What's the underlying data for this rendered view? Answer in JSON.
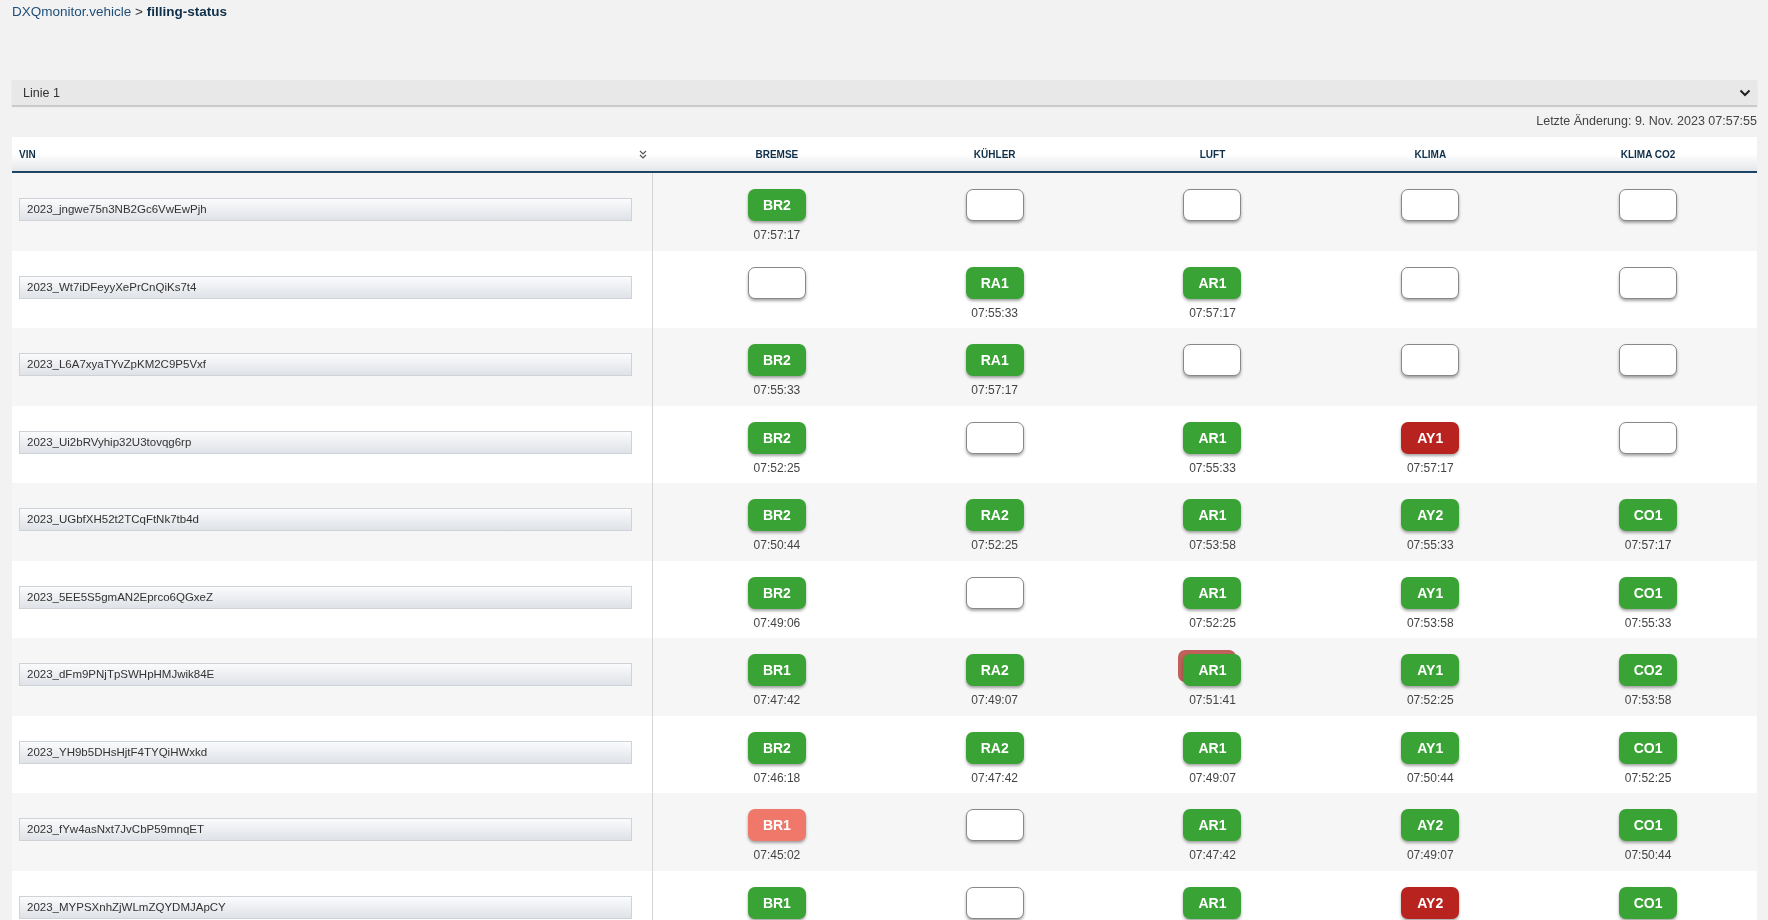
{
  "breadcrumb": {
    "parent": "DXQmonitor.vehicle",
    "separator": ">",
    "current": "filling-status"
  },
  "line_select": {
    "value": "Linie 1"
  },
  "last_change": "Letzte Änderung: 9. Nov. 2023 07:57:55",
  "columns": [
    "VIN",
    "BREMSE",
    "KÜHLER",
    "LUFT",
    "KLIMA",
    "KLIMA CO2"
  ],
  "rows": [
    {
      "vin": "2023_jngwe75n3NB2Gc6VwEwPjh",
      "cells": [
        {
          "color": "#3aa335",
          "label": "BR2",
          "time": "07:57:17"
        },
        {
          "color": "#ffffff"
        },
        {
          "color": "#ffffff"
        },
        {
          "color": "#ffffff"
        },
        {
          "color": "#ffffff"
        }
      ]
    },
    {
      "vin": "2023_Wt7iDFeyyXePrCnQiKs7t4",
      "cells": [
        {
          "color": "#ffffff"
        },
        {
          "color": "#3aa335",
          "label": "RA1",
          "time": "07:55:33"
        },
        {
          "color": "#3aa335",
          "label": "AR1",
          "time": "07:57:17"
        },
        {
          "color": "#ffffff"
        },
        {
          "color": "#ffffff"
        }
      ]
    },
    {
      "vin": "2023_L6A7xyaTYvZpKM2C9P5Vxf",
      "cells": [
        {
          "color": "#3aa335",
          "label": "BR2",
          "time": "07:55:33"
        },
        {
          "color": "#3aa335",
          "label": "RA1",
          "time": "07:57:17"
        },
        {
          "color": "#ffffff"
        },
        {
          "color": "#ffffff"
        },
        {
          "color": "#ffffff"
        }
      ]
    },
    {
      "vin": "2023_Ui2bRVyhip32U3tovqg6rp",
      "cells": [
        {
          "color": "#3aa335",
          "label": "BR2",
          "time": "07:52:25"
        },
        {
          "color": "#ffffff"
        },
        {
          "color": "#3aa335",
          "label": "AR1",
          "time": "07:55:33"
        },
        {
          "color": "#b8231f",
          "label": "AY1",
          "time": "07:57:17"
        },
        {
          "color": "#ffffff"
        }
      ]
    },
    {
      "vin": "2023_UGbfXH52t2TCqFtNk7tb4d",
      "cells": [
        {
          "color": "#3aa335",
          "label": "BR2",
          "time": "07:50:44"
        },
        {
          "color": "#3aa335",
          "label": "RA2",
          "time": "07:52:25"
        },
        {
          "color": "#3aa335",
          "label": "AR1",
          "time": "07:53:58"
        },
        {
          "color": "#3aa335",
          "label": "AY2",
          "time": "07:55:33"
        },
        {
          "color": "#3aa335",
          "label": "CO1",
          "time": "07:57:17"
        }
      ]
    },
    {
      "vin": "2023_5EE5S5gmAN2Eprco6QGxeZ",
      "cells": [
        {
          "color": "#3aa335",
          "label": "BR2",
          "time": "07:49:06"
        },
        {
          "color": "#ffffff"
        },
        {
          "color": "#3aa335",
          "label": "AR1",
          "time": "07:52:25"
        },
        {
          "color": "#3aa335",
          "label": "AY1",
          "time": "07:53:58"
        },
        {
          "color": "#3aa335",
          "label": "CO1",
          "time": "07:55:33"
        }
      ]
    },
    {
      "vin": "2023_dFm9PNjTpSWHpHMJwik84E",
      "cells": [
        {
          "color": "#3aa335",
          "label": "BR1",
          "time": "07:47:42"
        },
        {
          "color": "#3aa335",
          "label": "RA2",
          "time": "07:49:07"
        },
        {
          "color": "#3aa335",
          "label": "AR1",
          "time": "07:51:41",
          "underlay": {
            "color": "#c0605a"
          }
        },
        {
          "color": "#3aa335",
          "label": "AY1",
          "time": "07:52:25"
        },
        {
          "color": "#3aa335",
          "label": "CO2",
          "time": "07:53:58"
        }
      ]
    },
    {
      "vin": "2023_YH9b5DHsHjtF4TYQiHWxkd",
      "cells": [
        {
          "color": "#3aa335",
          "label": "BR2",
          "time": "07:46:18"
        },
        {
          "color": "#3aa335",
          "label": "RA2",
          "time": "07:47:42"
        },
        {
          "color": "#3aa335",
          "label": "AR1",
          "time": "07:49:07"
        },
        {
          "color": "#3aa335",
          "label": "AY1",
          "time": "07:50:44"
        },
        {
          "color": "#3aa335",
          "label": "CO1",
          "time": "07:52:25"
        }
      ]
    },
    {
      "vin": "2023_fYw4asNxt7JvCbP59mnqET",
      "cells": [
        {
          "color": "#f0786a",
          "label": "BR1",
          "time": "07:45:02"
        },
        {
          "color": "#ffffff"
        },
        {
          "color": "#3aa335",
          "label": "AR1",
          "time": "07:47:42"
        },
        {
          "color": "#3aa335",
          "label": "AY2",
          "time": "07:49:07"
        },
        {
          "color": "#3aa335",
          "label": "CO1",
          "time": "07:50:44"
        }
      ]
    },
    {
      "vin": "2023_MYPSXnhZjWLmZQYDMJApCY",
      "cells": [
        {
          "color": "#3aa335",
          "label": "BR1"
        },
        {
          "color": "#ffffff"
        },
        {
          "color": "#3aa335",
          "label": "AR1"
        },
        {
          "color": "#b8231f",
          "label": "AY2"
        },
        {
          "color": "#3aa335",
          "label": "CO1"
        }
      ]
    }
  ]
}
